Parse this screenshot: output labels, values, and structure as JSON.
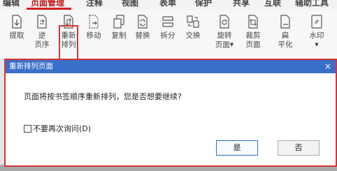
{
  "menubar": {
    "items": [
      {
        "label": "编辑",
        "active": false
      },
      {
        "label": "页面管理",
        "active": true
      },
      {
        "label": "注释",
        "active": false
      },
      {
        "label": "视图",
        "active": false
      },
      {
        "label": "表单",
        "active": false
      },
      {
        "label": "保护",
        "active": false
      },
      {
        "label": "共享",
        "active": false
      },
      {
        "label": "互联",
        "active": false
      },
      {
        "label": "辅助工具",
        "active": false
      }
    ]
  },
  "ribbon": {
    "tools": [
      {
        "label1": "提取",
        "label2": "",
        "icon": "extract-icon"
      },
      {
        "label1": "逆",
        "label2": "页序",
        "icon": "reverse-order-icon"
      },
      {
        "label1": "重新",
        "label2": "排列",
        "icon": "rearrange-icon"
      },
      {
        "label1": "移动",
        "label2": "",
        "icon": "move-icon"
      },
      {
        "label1": "复制",
        "label2": "",
        "icon": "copy-icon"
      },
      {
        "label1": "替换",
        "label2": "",
        "icon": "replace-icon"
      },
      {
        "label1": "拆分",
        "label2": "",
        "icon": "split-icon"
      },
      {
        "label1": "交换",
        "label2": "",
        "icon": "swap-icon"
      },
      {
        "label1": "旋转",
        "label2": "页面",
        "icon": "rotate-icon",
        "dropdown": true
      },
      {
        "label1": "裁剪",
        "label2": "页面",
        "icon": "crop-icon"
      },
      {
        "label1": "扁",
        "label2": "平化",
        "icon": "flatten-icon"
      },
      {
        "label1": "水印",
        "label2": "",
        "icon": "watermark-icon",
        "dropdown": true
      }
    ]
  },
  "dialog": {
    "title": "重新排列页面",
    "close_symbol": "×",
    "message": "页面将按书签顺序重新排列，您是否想要继续?",
    "checkbox_label": "不要再次询问(D)",
    "checkbox_checked": false,
    "yes_label": "是",
    "no_label": "否"
  },
  "colors": {
    "accent_red": "#d83333",
    "titlebar_blue": "#3a6fc9"
  }
}
